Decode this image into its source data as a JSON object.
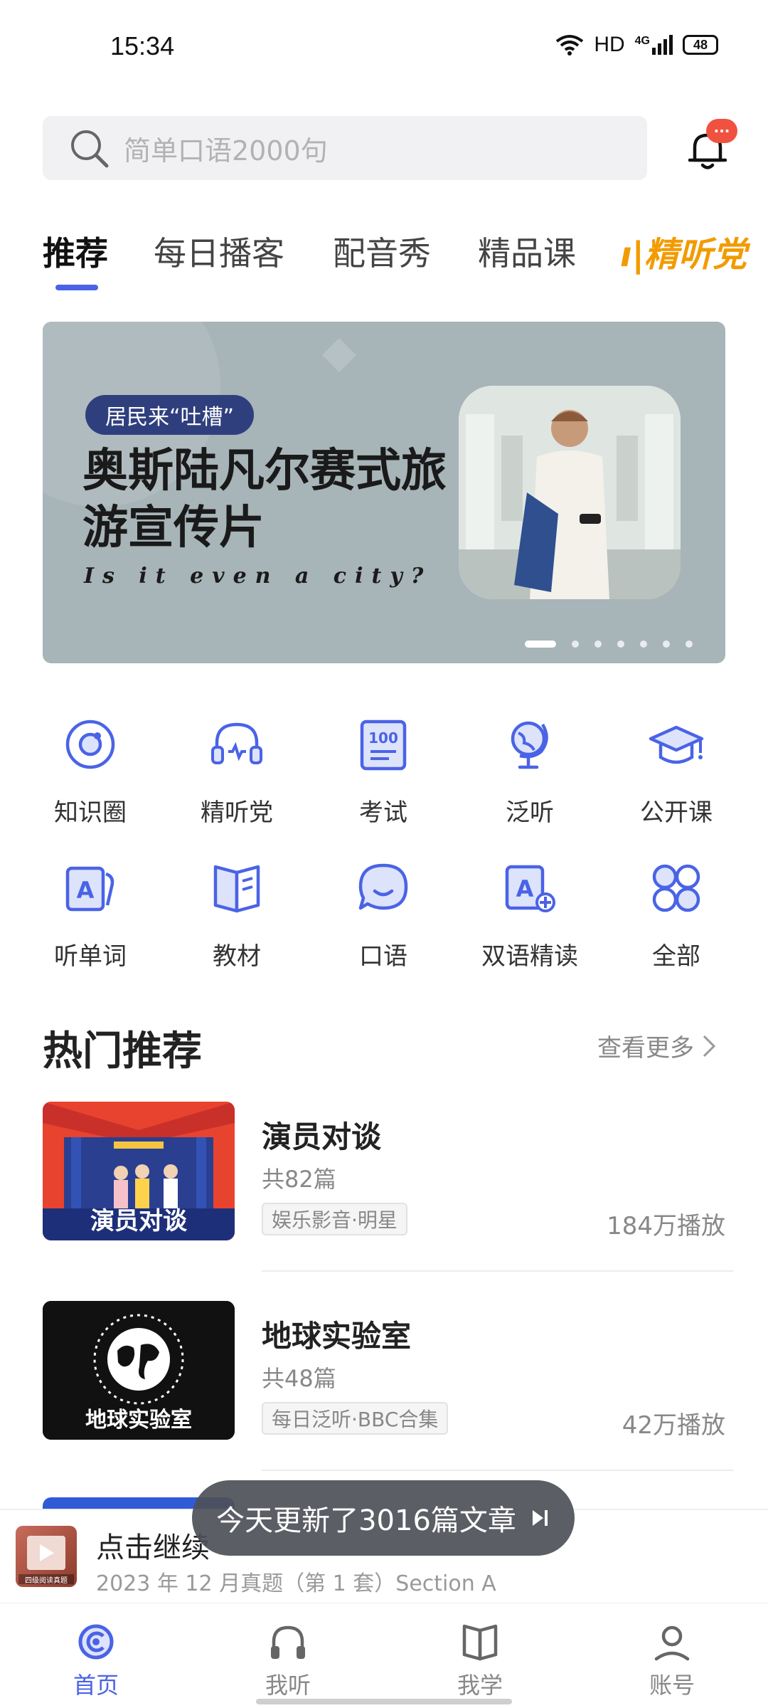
{
  "status_bar": {
    "time": "15:34",
    "network": "HD",
    "signal": "4G",
    "battery": "48"
  },
  "search": {
    "placeholder": "简单口语2000句",
    "badge": "···"
  },
  "tabs": [
    {
      "label": "推荐",
      "active": true
    },
    {
      "label": "每日播客"
    },
    {
      "label": "配音秀"
    },
    {
      "label": "精品课"
    },
    {
      "label": "精听党"
    }
  ],
  "banner": {
    "chip": "居民来“吐槽”",
    "title": "奥斯陆凡尔赛式旅游宣传片",
    "subtitle": "Is it even a city?",
    "slide_count": 7,
    "active_slide": 1
  },
  "quick_grid": [
    {
      "label": "知识圈",
      "icon": "knowledge-circle-icon"
    },
    {
      "label": "精听党",
      "icon": "headset-icon"
    },
    {
      "label": "考试",
      "icon": "exam-100-icon"
    },
    {
      "label": "泛听",
      "icon": "globe-icon"
    },
    {
      "label": "公开课",
      "icon": "graduation-cap-icon"
    },
    {
      "label": "听单词",
      "icon": "word-card-icon"
    },
    {
      "label": "教材",
      "icon": "book-icon"
    },
    {
      "label": "口语",
      "icon": "chat-bubble-icon"
    },
    {
      "label": "双语精读",
      "icon": "bilingual-read-icon"
    },
    {
      "label": "全部",
      "icon": "all-grid-icon"
    }
  ],
  "hot": {
    "title": "热门推荐",
    "more": "查看更多",
    "items": [
      {
        "thumb_text": "演员对谈",
        "title": "演员对谈",
        "count": "共82篇",
        "tag": "娱乐影音·明星",
        "plays": "184万播放"
      },
      {
        "thumb_text": "地球实验室",
        "title": "地球实验室",
        "count": "共48篇",
        "tag": "每日泛听·BBC合集",
        "plays": "42万播放"
      }
    ]
  },
  "toast": {
    "text": "今天更新了3016篇文章"
  },
  "player": {
    "title": "点击继续",
    "subtitle": "2023 年 12 月真题（第 1 套）Section A",
    "thumb_text": "四级阅读真题"
  },
  "bottom_nav": [
    {
      "label": "首页",
      "icon": "home-icon",
      "active": true
    },
    {
      "label": "我听",
      "icon": "headphones-icon"
    },
    {
      "label": "我学",
      "icon": "open-book-icon"
    },
    {
      "label": "账号",
      "icon": "account-icon"
    }
  ],
  "colors": {
    "accent": "#4a63e6",
    "badge": "#f0523f",
    "banner_bg": "#a7b4b8",
    "tab_highlight": "#f29b00"
  }
}
